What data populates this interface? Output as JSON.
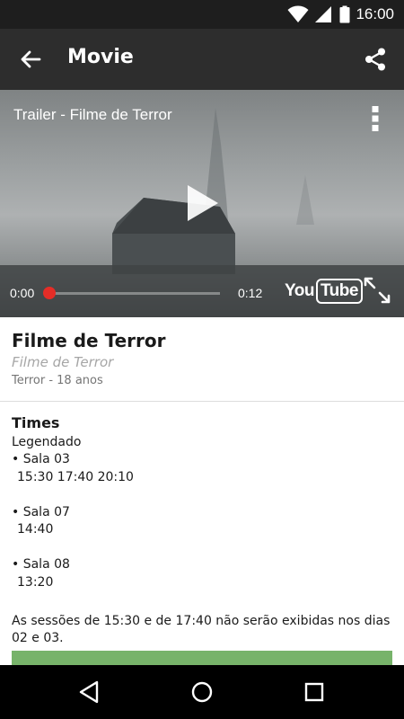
{
  "status_bar": {
    "time": "16:00"
  },
  "app_bar": {
    "title": "Movie",
    "back_icon": "arrow-back-icon",
    "share_icon": "share-icon"
  },
  "video": {
    "title": "Trailer - Filme de Terror",
    "current_time": "0:00",
    "total_time": "0:12",
    "progress": 0,
    "logo_you": "You",
    "logo_tube": "Tube",
    "accent_color": "#e52d27"
  },
  "movie": {
    "title": "Filme de Terror",
    "original_title": "Filme de Terror",
    "meta": "Terror - 18 anos"
  },
  "times": {
    "heading": "Times",
    "type": "Legendado",
    "rooms": [
      {
        "name": "• Sala 03",
        "hours": "15:30 17:40 20:10"
      },
      {
        "name": "• Sala 07",
        "hours": "14:40"
      },
      {
        "name": "• Sala 08",
        "hours": "13:20"
      }
    ],
    "notice": "As sessões de 15:30 e de 17:40 não serão exibidas nos dias 02 e 03."
  },
  "colors": {
    "button_green": "#77b36a",
    "app_bar": "#2d2d2d",
    "status_bar": "#1e1e1e"
  }
}
